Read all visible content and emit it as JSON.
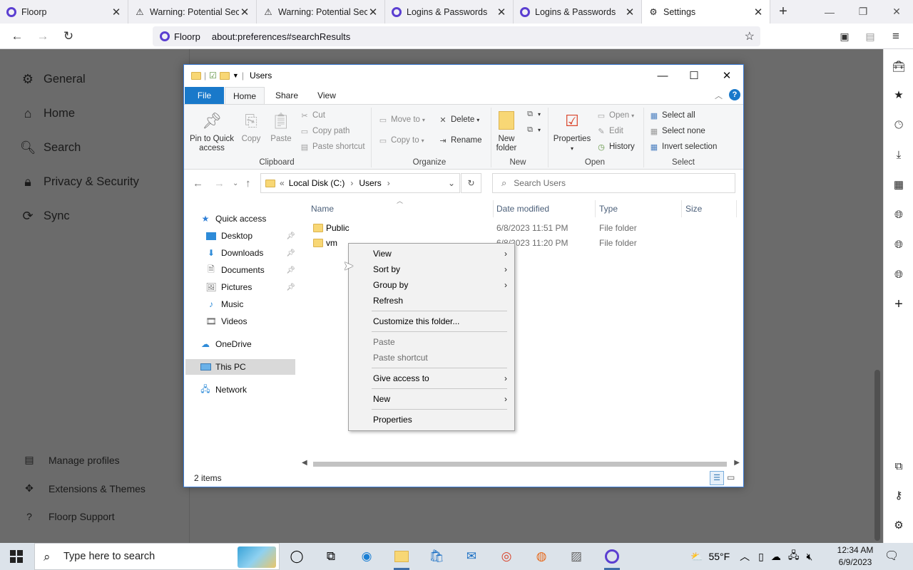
{
  "browser": {
    "tabs": [
      {
        "label": "Floorp",
        "icon": "floorp-icon"
      },
      {
        "label": "Warning: Potential Secu",
        "icon": "warning-icon"
      },
      {
        "label": "Warning: Potential Secu",
        "icon": "warning-icon"
      },
      {
        "label": "Logins & Passwords",
        "icon": "floorp-icon"
      },
      {
        "label": "Logins & Passwords",
        "icon": "floorp-icon"
      },
      {
        "label": "Settings",
        "icon": "gear-icon"
      }
    ],
    "url_brand": "Floorp",
    "url": "about:preferences#searchResults"
  },
  "settings": {
    "categories": [
      "General",
      "Home",
      "Search",
      "Privacy & Security",
      "Sync"
    ],
    "footer": [
      "Manage profiles",
      "Extensions & Themes",
      "Floorp Support"
    ]
  },
  "explorer": {
    "title": "Users",
    "ribbon_tabs": {
      "file": "File",
      "home": "Home",
      "share": "Share",
      "view": "View"
    },
    "clipboard": {
      "pin_line1": "Pin to Quick",
      "pin_line2": "access",
      "copy": "Copy",
      "paste": "Paste",
      "cut": "Cut",
      "copy_path": "Copy path",
      "paste_shortcut": "Paste shortcut",
      "group": "Clipboard"
    },
    "organize": {
      "move_to": "Move to",
      "copy_to": "Copy to",
      "delete": "Delete",
      "rename": "Rename",
      "group": "Organize"
    },
    "new": {
      "new_folder_line1": "New",
      "new_folder_line2": "folder",
      "group": "New"
    },
    "open": {
      "properties": "Properties",
      "open": "Open",
      "edit": "Edit",
      "history": "History",
      "group": "Open"
    },
    "select": {
      "select_all": "Select all",
      "select_none": "Select none",
      "invert": "Invert selection",
      "group": "Select"
    },
    "address": {
      "crumb1": "Local Disk (C:)",
      "crumb2": "Users"
    },
    "search_placeholder": "Search Users",
    "nav": {
      "quick_access": "Quick access",
      "desktop": "Desktop",
      "downloads": "Downloads",
      "documents": "Documents",
      "pictures": "Pictures",
      "music": "Music",
      "videos": "Videos",
      "onedrive": "OneDrive",
      "this_pc": "This PC",
      "network": "Network"
    },
    "columns": {
      "name": "Name",
      "date": "Date modified",
      "type": "Type",
      "size": "Size"
    },
    "files": [
      {
        "name": "Public",
        "date": "6/8/2023 11:51 PM",
        "type": "File folder"
      },
      {
        "name": "vm",
        "date": "6/8/2023 11:20 PM",
        "type": "File folder"
      }
    ],
    "status": "2 items"
  },
  "context_menu": {
    "view": "View",
    "sort_by": "Sort by",
    "group_by": "Group by",
    "refresh": "Refresh",
    "customize": "Customize this folder...",
    "paste": "Paste",
    "paste_shortcut": "Paste shortcut",
    "give_access": "Give access to",
    "new": "New",
    "properties": "Properties"
  },
  "taskbar": {
    "search_placeholder": "Type here to search",
    "weather": "55°F",
    "time": "12:34 AM",
    "date": "6/9/2023"
  }
}
